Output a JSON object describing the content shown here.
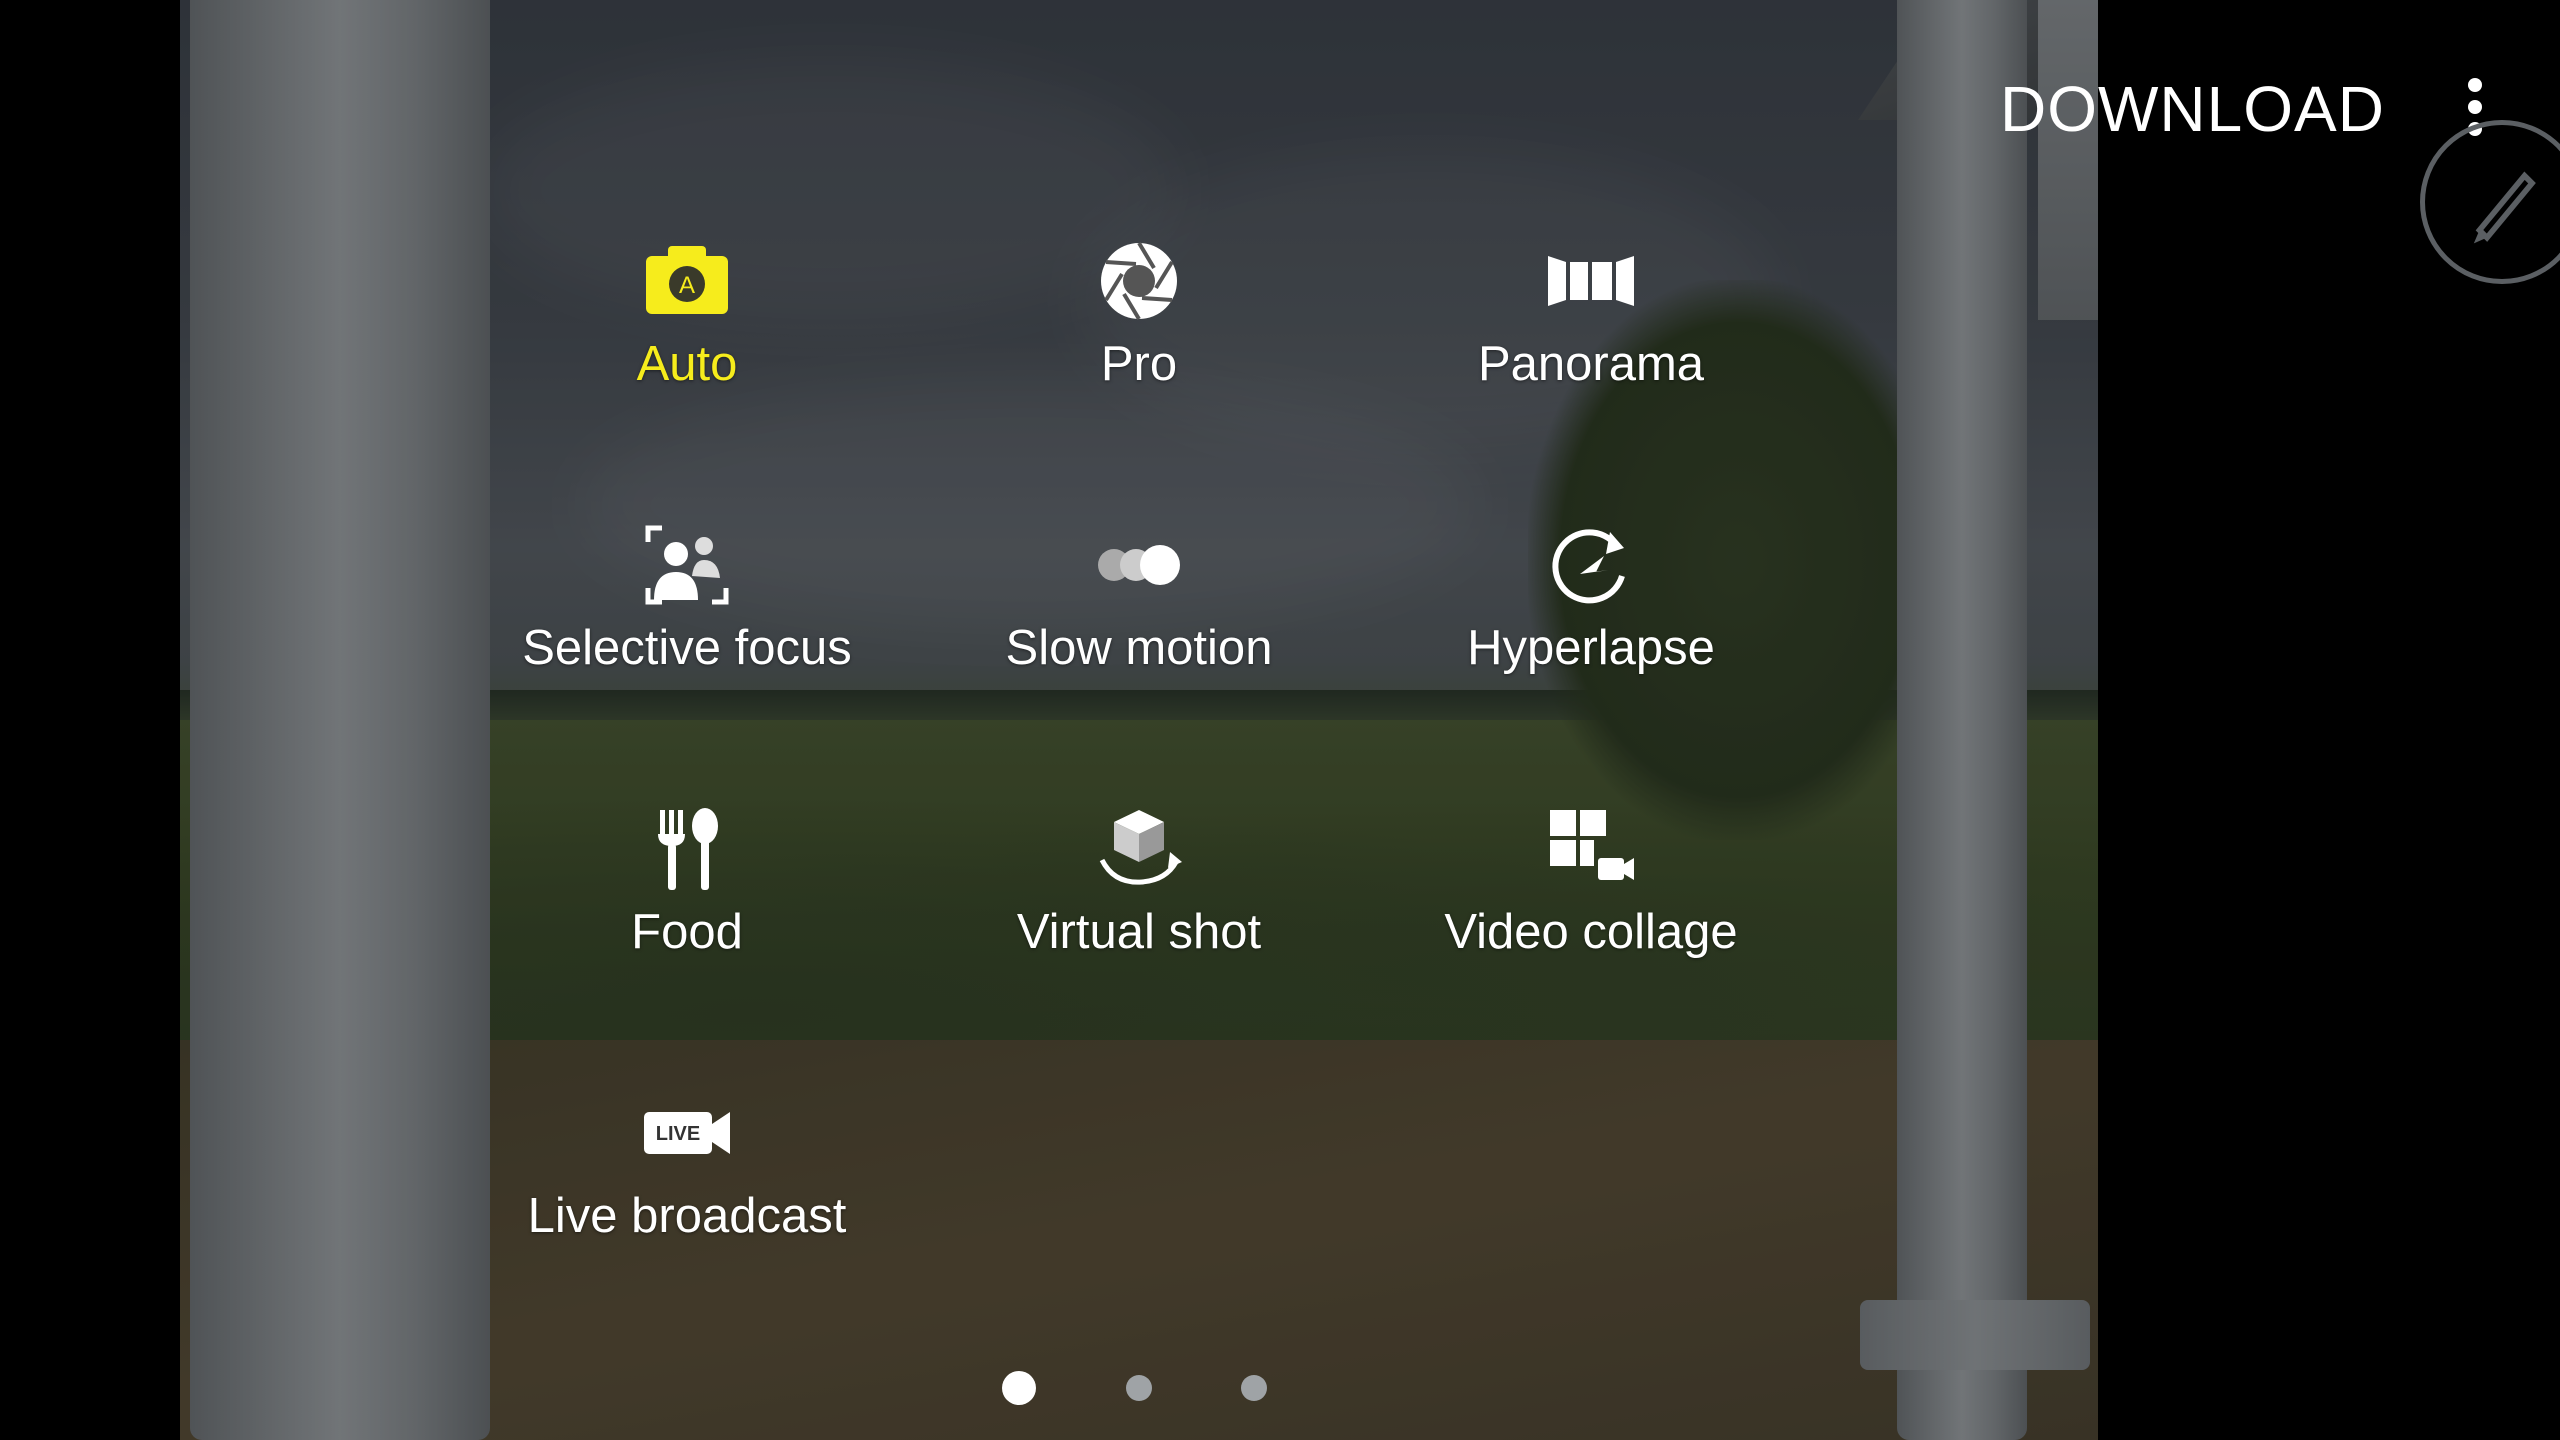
{
  "top_bar": {
    "download_label": "DOWNLOAD",
    "more_icon": "more-vert-icon",
    "edit_icon": "pen-icon"
  },
  "modes": [
    {
      "label": "Auto",
      "icon": "camera-auto-icon",
      "active": true
    },
    {
      "label": "Pro",
      "icon": "aperture-icon",
      "active": false
    },
    {
      "label": "Panorama",
      "icon": "panorama-icon",
      "active": false
    },
    {
      "label": "Selective focus",
      "icon": "selective-focus-icon",
      "active": false
    },
    {
      "label": "Slow motion",
      "icon": "slow-motion-icon",
      "active": false
    },
    {
      "label": "Hyperlapse",
      "icon": "hyperlapse-icon",
      "active": false
    },
    {
      "label": "Food",
      "icon": "food-icon",
      "active": false
    },
    {
      "label": "Virtual shot",
      "icon": "virtual-shot-icon",
      "active": false
    },
    {
      "label": "Video collage",
      "icon": "video-collage-icon",
      "active": false
    },
    {
      "label": "Live broadcast",
      "icon": "live-broadcast-icon",
      "icon_text": "LIVE",
      "active": false
    }
  ],
  "pager": {
    "pages": 3,
    "current": 1
  },
  "colors": {
    "active": "#f6ec1c",
    "text": "#ffffff",
    "background": "#000000"
  }
}
